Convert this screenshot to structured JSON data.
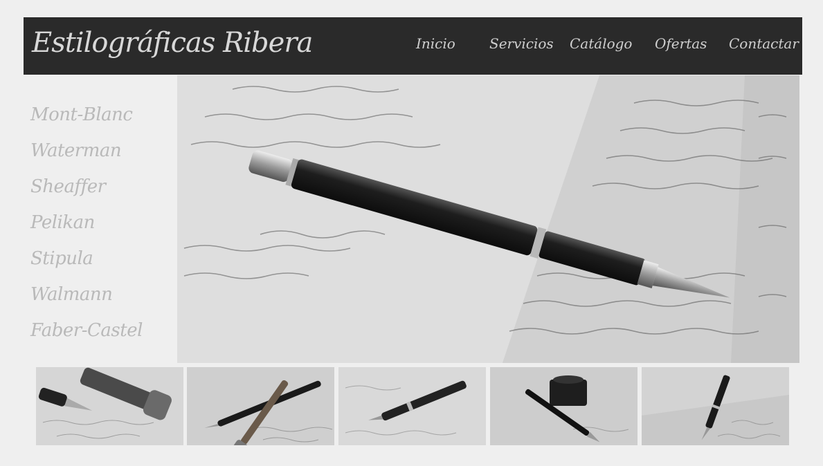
{
  "header": {
    "logo_text": "Estilográficas Ribera",
    "nav": [
      {
        "label": "Inicio"
      },
      {
        "label": "Servicios"
      },
      {
        "label": "Catálogo"
      },
      {
        "label": "Ofertas"
      },
      {
        "label": "Contactar"
      }
    ]
  },
  "sidebar": {
    "brands": [
      {
        "label": "Mont-Blanc"
      },
      {
        "label": "Waterman"
      },
      {
        "label": "Sheaffer"
      },
      {
        "label": "Pelikan"
      },
      {
        "label": "Stipula"
      },
      {
        "label": "Walmann"
      },
      {
        "label": "Faber-Castel"
      }
    ]
  },
  "colors": {
    "page_bg": "#efefef",
    "header_bg": "#2a2a2a",
    "header_text": "#d8d8d8",
    "sidebar_text": "#b9b9b9"
  }
}
